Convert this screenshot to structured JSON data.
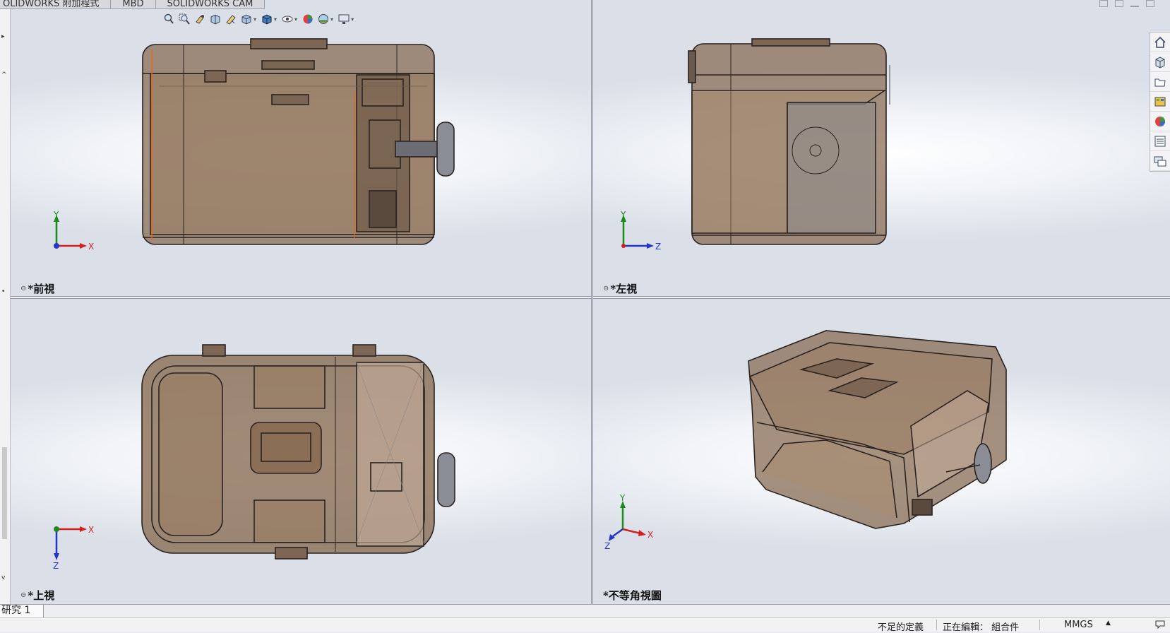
{
  "tabs": [
    "OLIDWORKS 附加程式",
    "MBD",
    "SOLIDWORKS CAM"
  ],
  "viewports": {
    "front": {
      "label": "*前視"
    },
    "left": {
      "label": "*左視"
    },
    "top": {
      "label": "*上視"
    },
    "iso": {
      "label": "*不等角視圖"
    }
  },
  "triad": {
    "x": "X",
    "y": "Y",
    "z": "Z"
  },
  "bottom_tab": {
    "label": "研究 1"
  },
  "status": {
    "definition": "不足的定義",
    "editing": "正在編輯： 組合件",
    "units": "MMGS"
  },
  "colors": {
    "body": "#8a6e55",
    "edge": "#2b2320",
    "axis_x": "#d42020",
    "axis_y": "#1c8a1c",
    "axis_z": "#2535c8"
  },
  "icons": {
    "view_toolbar": [
      "zoom-to-fit-icon",
      "zoom-to-area-icon",
      "previous-view-icon",
      "section-view-icon",
      "dynamic-annotation-icon",
      "view-orientation-icon",
      "display-style-icon",
      "hide-show-icon",
      "edit-appearance-icon",
      "apply-scene-icon",
      "view-settings-icon"
    ],
    "task_pane": [
      "home-icon",
      "design-library-icon",
      "file-explorer-icon",
      "view-palette-icon",
      "appearances-icon",
      "custom-properties-icon",
      "forum-icon"
    ]
  }
}
